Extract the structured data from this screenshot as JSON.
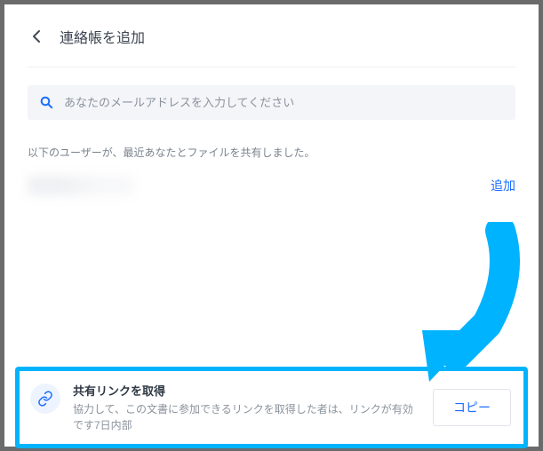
{
  "header": {
    "title": "連絡帳を追加"
  },
  "search": {
    "placeholder": "あなたのメールアドレスを入力してください"
  },
  "recent": {
    "label": "以下のユーザーが、最近あなたとファイルを共有しました。",
    "add_label": "追加"
  },
  "share_link": {
    "title": "共有リンクを取得",
    "description": "協力して、この文書に参加できるリンクを取得した者は、リンクが有効です7日内部",
    "copy_label": "コピー"
  },
  "colors": {
    "accent": "#1a6dff",
    "highlight": "#00b3ff"
  }
}
